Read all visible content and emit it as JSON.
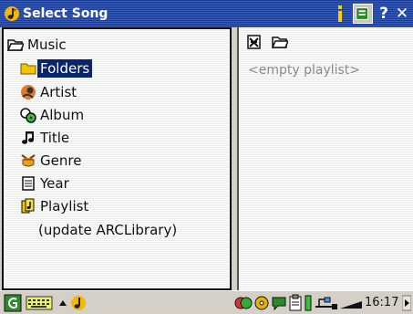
{
  "window": {
    "title": "Select Song",
    "buttons": {
      "help": "?",
      "close": "✕"
    }
  },
  "tree": {
    "root": {
      "label": "Music",
      "icon": "open-folder-icon"
    },
    "items": [
      {
        "label": "Folders",
        "icon": "folder-icon",
        "selected": true
      },
      {
        "label": "Artist",
        "icon": "artist-icon"
      },
      {
        "label": "Album",
        "icon": "album-icon"
      },
      {
        "label": "Title",
        "icon": "music-note-icon"
      },
      {
        "label": "Genre",
        "icon": "genre-icon"
      },
      {
        "label": "Year",
        "icon": "calendar-icon"
      },
      {
        "label": "Playlist",
        "icon": "playlist-icon"
      },
      {
        "label": "(update ARCLibrary)"
      }
    ]
  },
  "playlist": {
    "empty_text": "<empty playlist>"
  },
  "taskbar": {
    "time": "16:17"
  },
  "colors": {
    "titlebar": "#2a5bd0",
    "selection": "#0a246a",
    "panel": "#d4d0c8"
  }
}
